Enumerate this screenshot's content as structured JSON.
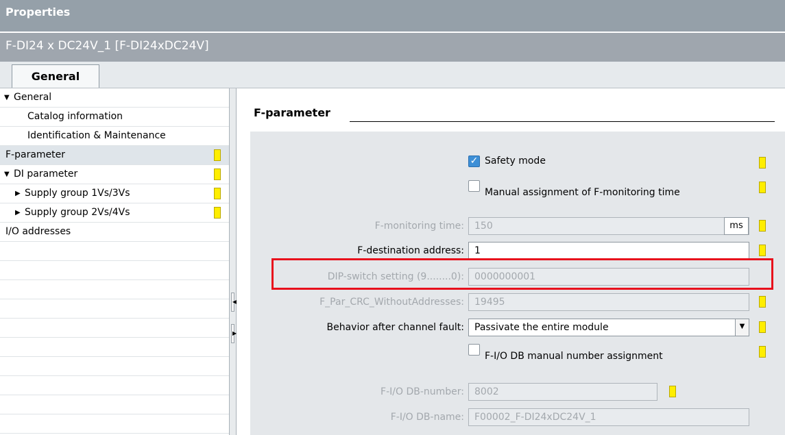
{
  "window": {
    "title": "Properties",
    "subtitle": "F-DI24 x DC24V_1 [F-DI24xDC24V]"
  },
  "tabs": [
    {
      "label": "General"
    }
  ],
  "tree": {
    "items": [
      {
        "label": "General",
        "arrow": "▼",
        "selected": false,
        "flag": false
      },
      {
        "label": "Catalog information",
        "arrow": "",
        "selected": false,
        "flag": false
      },
      {
        "label": "Identification & Maintenance",
        "arrow": "",
        "selected": false,
        "flag": false
      },
      {
        "label": "F-parameter",
        "arrow": "",
        "selected": true,
        "flag": true
      },
      {
        "label": "DI parameter",
        "arrow": "▼",
        "selected": false,
        "flag": true
      },
      {
        "label": "Supply group 1Vs/3Vs",
        "arrow": "▶",
        "selected": false,
        "flag": true
      },
      {
        "label": "Supply group 2Vs/4Vs",
        "arrow": "▶",
        "selected": false,
        "flag": true
      },
      {
        "label": "I/O addresses",
        "arrow": "",
        "selected": false,
        "flag": false
      }
    ]
  },
  "section": {
    "title": "F-parameter"
  },
  "form": {
    "safety_mode": {
      "label": "Safety mode",
      "checked": true
    },
    "manual_assignment": {
      "label": "Manual assignment of F-monitoring time",
      "checked": false
    },
    "monitoring_time": {
      "label": "F-monitoring time:",
      "value": "150",
      "unit": "ms"
    },
    "destination_address": {
      "label": "F-destination address:",
      "value": "1"
    },
    "dip_switch": {
      "label": "DIP-switch setting (9........0):",
      "value": "0000000001"
    },
    "crc": {
      "label": "F_Par_CRC_WithoutAddresses:",
      "value": "19495"
    },
    "behavior": {
      "label": "Behavior after channel fault:",
      "value": "Passivate the entire module"
    },
    "db_manual": {
      "label": "F-I/O DB manual number assignment",
      "checked": false
    },
    "db_number": {
      "label": "F-I/O DB-number:",
      "value": "8002"
    },
    "db_name": {
      "label": "F-I/O DB-name:",
      "value": "F00002_F-DI24xDC24V_1"
    }
  },
  "colors": {
    "accent_highlight": "#e8101c",
    "flag": "#ffee00",
    "checkbox": "#3d8fd6"
  }
}
